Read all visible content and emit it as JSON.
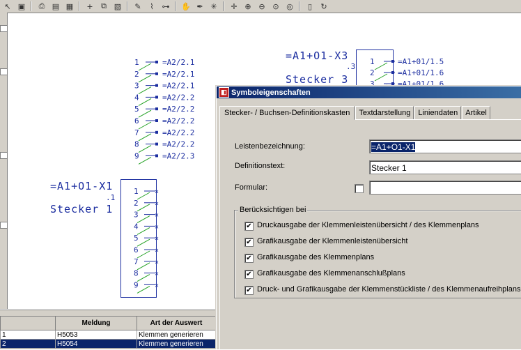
{
  "colors": {
    "cad_blue": "#1c2ea0",
    "cad_green": "#20a020",
    "arrow_red": "#e02020",
    "title_bar": "#0a246a",
    "selection": "#0a246a"
  },
  "toolbar": {
    "icons": [
      "cursor-icon",
      "save-icon",
      "print-icon",
      "layers-icon",
      "grid-icon",
      "plus-icon",
      "copy-icon",
      "paste-icon",
      "draw-icon",
      "wire-icon",
      "connect-icon",
      "hand-icon",
      "pen-icon",
      "snap-icon",
      "crosshair-icon",
      "zoom-in-icon",
      "zoom-out-icon",
      "zoom-fit-icon",
      "zoom-100-icon",
      "doc-icon",
      "refresh-icon"
    ]
  },
  "canvas": {
    "strip_top": {
      "terminals": [
        "1",
        "2",
        "3",
        "4",
        "5",
        "6",
        "7",
        "8",
        "9"
      ],
      "targets": [
        "=A2/2.1",
        "=A2/2.1",
        "=A2/2.1",
        "=A2/2.2",
        "=A2/2.2",
        "=A2/2.2",
        "=A2/2.2",
        "=A2/2.2",
        "=A2/2.3"
      ]
    },
    "strip_x3": {
      "name": "=A1+O1-X3",
      "index": ".3",
      "title": "Stecker 3",
      "terminals": [
        "1",
        "2",
        "3"
      ],
      "targets": [
        "=A1+01/1.5",
        "=A1+01/1.6",
        "=A1+01/1.6"
      ]
    },
    "strip_x1": {
      "name": "=A1+O1-X1",
      "index": ".1",
      "title": "Stecker 1",
      "terminals": [
        "1",
        "2",
        "3",
        "4",
        "5",
        "6",
        "7",
        "8",
        "9"
      ]
    }
  },
  "messages": {
    "columns": [
      "",
      "Meldung",
      "Art der Auswert"
    ],
    "rows": [
      {
        "num": "1",
        "code": "H5053",
        "text": "Klemmen generieren",
        "selected": false
      },
      {
        "num": "2",
        "code": "H5054",
        "text": "Klemmen generieren",
        "selected": true
      }
    ]
  },
  "dialog": {
    "title": "Symboleigenschaften",
    "tabs": [
      "Stecker- / Buchsen-Definitionskasten",
      "Textdarstellung",
      "Liniendaten",
      "Artikel"
    ],
    "fields": {
      "leisten_label": "Leistenbezeichnung:",
      "leisten_value": "=A1+O1-X1",
      "definition_label": "Definitionstext:",
      "definition_value": "Stecker 1",
      "formular_label": "Formular:",
      "formular_value": ""
    },
    "group_title": "Berücksichtigen bei",
    "options": [
      "Druckausgabe der Klemmenleistenübersicht / des Klemmenplans",
      "Grafikausgabe der Klemmenleistenübersicht",
      "Grafikausgabe des Klemmenplans",
      "Grafikausgabe des Klemmenanschlußplans",
      "Druck- und Grafikausgabe der Klemmenstückliste / des Klemmenaufreihplans"
    ]
  }
}
